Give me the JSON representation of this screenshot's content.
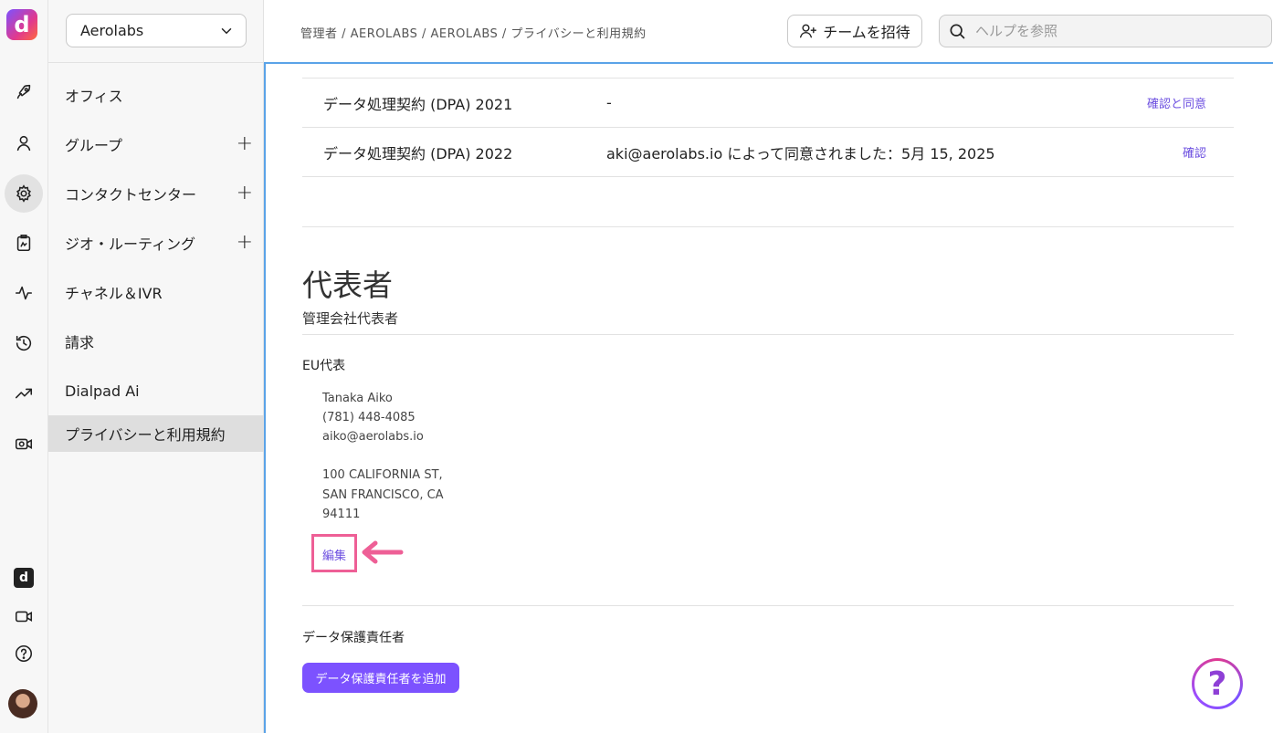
{
  "sidebar": {
    "org_name": "Aerolabs",
    "items": [
      {
        "label": "オフィス",
        "has_plus": false
      },
      {
        "label": "グループ",
        "has_plus": true
      },
      {
        "label": "コンタクトセンター",
        "has_plus": true
      },
      {
        "label": "ジオ・ルーティング",
        "has_plus": true
      },
      {
        "label": "チャネル＆IVR",
        "has_plus": false
      },
      {
        "label": "請求",
        "has_plus": false
      },
      {
        "label": "Dialpad Ai",
        "has_plus": false
      },
      {
        "label": "プライバシーと利用規約",
        "has_plus": false,
        "active": true
      }
    ],
    "plus_glyph": "+"
  },
  "rail": {
    "logo_letter": "d",
    "bottom_logo_letter": "d",
    "icons": [
      "rocket-icon",
      "person-icon",
      "gear-icon",
      "clipboard-icon",
      "activity-icon",
      "history-icon",
      "trending-icon",
      "camera-icon",
      "dialpad-ai-icon",
      "video-icon",
      "help-icon"
    ]
  },
  "topbar": {
    "breadcrumb": "管理者 / AEROLABS / AEROLABS / プライバシーと利用規約",
    "invite_label": "チームを招待",
    "search_placeholder": "ヘルプを参照"
  },
  "dpa": {
    "rows": [
      {
        "name": "データ処理契約 (DPA) 2021",
        "status": "-",
        "action": "確認と同意"
      },
      {
        "name": "データ処理契約 (DPA) 2022",
        "status": "aki@aerolabs.io によって同意されました：5月 15, 2025",
        "action": "確認"
      }
    ]
  },
  "representatives": {
    "title": "代表者",
    "subtitle": "管理会社代表者",
    "eu": {
      "heading": "EU代表",
      "name": "Tanaka Aiko",
      "phone": "(781) 448-4085",
      "email": "aiko@aerolabs.io",
      "address1": "100 CALIFORNIA ST,",
      "address2": "SAN FRANCISCO, CA",
      "zip": "94111",
      "edit_label": "編集"
    },
    "dpo": {
      "heading": "データ保護責任者",
      "add_label": "データ保護責任者を追加"
    }
  },
  "help_fab": "?",
  "colors": {
    "accent": "#7c52ff",
    "link": "#6c4fe0",
    "highlight": "#ee5f96",
    "focus_border": "#5aa3e8"
  }
}
